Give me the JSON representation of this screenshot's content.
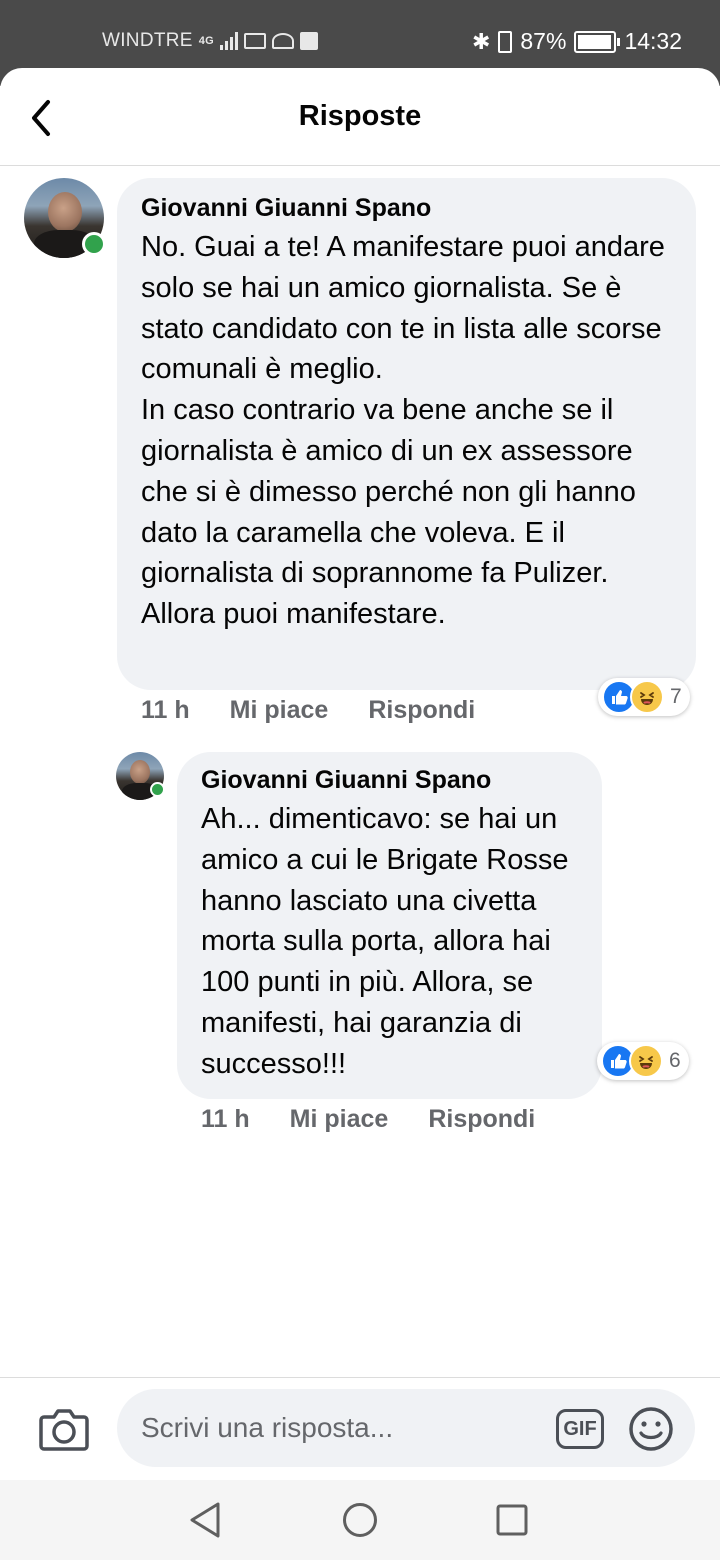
{
  "status_bar": {
    "carrier": "WINDTRE",
    "network": "4G",
    "battery": "87%",
    "time": "14:32"
  },
  "header": {
    "title": "Risposte"
  },
  "comments": [
    {
      "author": "Giovanni Giuanni Spano",
      "text": "No. Guai a te! A manifestare puoi andare solo se hai un amico giornalista. Se è stato candidato con te in lista alle scorse comunali è meglio.\nIn caso contrario va bene anche se il giornalista è amico di un ex assessore che si è dimesso perché non gli hanno dato la caramella che voleva. E il giornalista di soprannome fa Pulizer. Allora puoi manifestare.",
      "time": "11 h",
      "like_label": "Mi piace",
      "reply_label": "Rispondi",
      "reaction_count": "7",
      "reactions": [
        "like-icon",
        "haha-icon"
      ]
    },
    {
      "author": "Giovanni Giuanni Spano",
      "text": "Ah... dimenticavo: se hai un amico a cui le Brigate Rosse hanno lasciato una civetta morta sulla porta, allora hai 100 punti in più. Allora, se manifesti, hai garanzia di successo!!!",
      "time": "11 h",
      "like_label": "Mi piace",
      "reply_label": "Rispondi",
      "reaction_count": "6",
      "reactions": [
        "like-icon",
        "haha-icon"
      ]
    }
  ],
  "composer": {
    "placeholder": "Scrivi una risposta...",
    "gif_label": "GIF"
  },
  "colors": {
    "bubble_bg": "#f0f2f5",
    "secondary_text": "#65676b",
    "online_green": "#31a24c",
    "like_blue": "#1877f2",
    "status_bar_bg": "#4a4a4a"
  }
}
